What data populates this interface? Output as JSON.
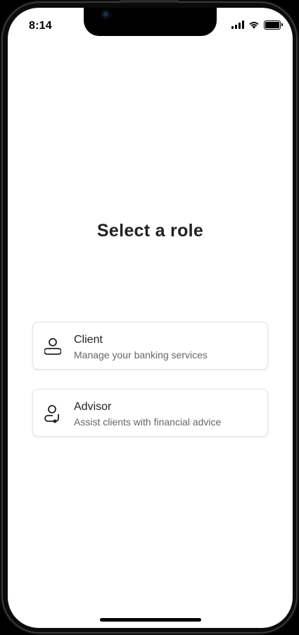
{
  "status_bar": {
    "time": "8:14",
    "icons": [
      "cellular-signal-icon",
      "wifi-icon",
      "battery-icon"
    ],
    "battery_level": 1.0
  },
  "page": {
    "title": "Select a role"
  },
  "roles": [
    {
      "name": "Client",
      "description": "Manage your banking services",
      "icon": "user-icon"
    },
    {
      "name": "Advisor",
      "description": "Assist clients with financial advice",
      "icon": "user-headset-icon"
    }
  ],
  "colors": {
    "background": "#ffffff",
    "title": "#222222",
    "card_border": "#e2e2e2",
    "description": "#666666"
  }
}
